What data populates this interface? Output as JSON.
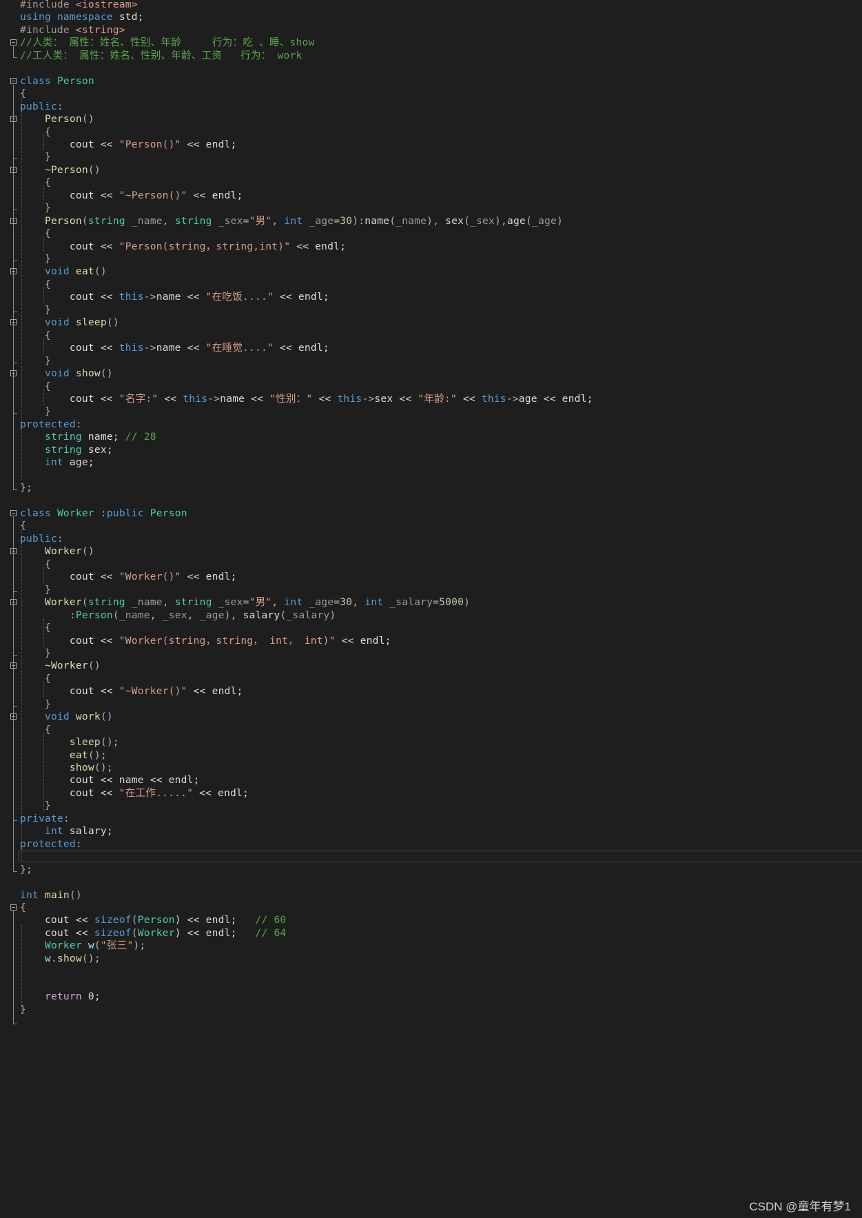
{
  "editor": {
    "lines": [
      [
        [
          "#include ",
          "pp"
        ],
        [
          "<iostream>",
          "str"
        ]
      ],
      [
        [
          "using",
          "kw"
        ],
        [
          " ",
          "tx"
        ],
        [
          "namespace",
          "kw"
        ],
        [
          " std;",
          "tx"
        ]
      ],
      [
        [
          "#include ",
          "pp"
        ],
        [
          "<string>",
          "str"
        ]
      ],
      [
        [
          "//人类： 属性：姓名、性别、年龄     行为：吃 、睡、show",
          "cm"
        ]
      ],
      [
        [
          "//工人类： 属性：姓名、性别、年龄、工资   行为： work",
          "cm"
        ]
      ],
      [],
      [
        [
          "class",
          "kw"
        ],
        [
          " ",
          "tx"
        ],
        [
          "Person",
          "cls"
        ]
      ],
      [
        [
          "{",
          "pn"
        ]
      ],
      [
        [
          "public",
          "kw"
        ],
        [
          ":",
          "pn"
        ]
      ],
      [
        [
          "    ",
          "tx"
        ],
        [
          "Person",
          "fn"
        ],
        [
          "()",
          "pn"
        ]
      ],
      [
        [
          "    {",
          "pn"
        ]
      ],
      [
        [
          "        cout << ",
          "tx"
        ],
        [
          "\"Person()\"",
          "str"
        ],
        [
          " << endl;",
          "tx"
        ]
      ],
      [
        [
          "    }",
          "pn"
        ]
      ],
      [
        [
          "    ~",
          "tx"
        ],
        [
          "Person",
          "fn"
        ],
        [
          "()",
          "pn"
        ]
      ],
      [
        [
          "    {",
          "pn"
        ]
      ],
      [
        [
          "        cout << ",
          "tx"
        ],
        [
          "\"~Person()\"",
          "str"
        ],
        [
          " << endl;",
          "tx"
        ]
      ],
      [
        [
          "    }",
          "pn"
        ]
      ],
      [
        [
          "    ",
          "tx"
        ],
        [
          "Person",
          "fn"
        ],
        [
          "(",
          "pn"
        ],
        [
          "string",
          "cls"
        ],
        [
          " ",
          "tx"
        ],
        [
          "_name",
          "prm"
        ],
        [
          ", ",
          "pn"
        ],
        [
          "string",
          "cls"
        ],
        [
          " ",
          "tx"
        ],
        [
          "_sex",
          "prm"
        ],
        [
          "=",
          "pn"
        ],
        [
          "\"男\"",
          "str"
        ],
        [
          ", ",
          "pn"
        ],
        [
          "int",
          "kw"
        ],
        [
          " ",
          "tx"
        ],
        [
          "_age",
          "prm"
        ],
        [
          "=",
          "pn"
        ],
        [
          "30",
          "num"
        ],
        [
          "):",
          "pn"
        ],
        [
          "name",
          "mem"
        ],
        [
          "(",
          "pn"
        ],
        [
          "_name",
          "prm"
        ],
        [
          "), ",
          "pn"
        ],
        [
          "sex",
          "mem"
        ],
        [
          "(",
          "pn"
        ],
        [
          "_sex",
          "prm"
        ],
        [
          "),",
          "pn"
        ],
        [
          "age",
          "mem"
        ],
        [
          "(",
          "pn"
        ],
        [
          "_age",
          "prm"
        ],
        [
          ")",
          "pn"
        ]
      ],
      [
        [
          "    {",
          "pn"
        ]
      ],
      [
        [
          "        cout << ",
          "tx"
        ],
        [
          "\"Person(string，string,int)\"",
          "str"
        ],
        [
          " << endl;",
          "tx"
        ]
      ],
      [
        [
          "    }",
          "pn"
        ]
      ],
      [
        [
          "    ",
          "tx"
        ],
        [
          "void",
          "kw"
        ],
        [
          " ",
          "tx"
        ],
        [
          "eat",
          "fn"
        ],
        [
          "()",
          "pn"
        ]
      ],
      [
        [
          "    {",
          "pn"
        ]
      ],
      [
        [
          "        cout << ",
          "tx"
        ],
        [
          "this",
          "kw"
        ],
        [
          "->",
          "pn"
        ],
        [
          "name",
          "mem"
        ],
        [
          " << ",
          "tx"
        ],
        [
          "\"在吃饭....\"",
          "str"
        ],
        [
          " << endl;",
          "tx"
        ]
      ],
      [
        [
          "    }",
          "pn"
        ]
      ],
      [
        [
          "    ",
          "tx"
        ],
        [
          "void",
          "kw"
        ],
        [
          " ",
          "tx"
        ],
        [
          "sleep",
          "fn"
        ],
        [
          "()",
          "pn"
        ]
      ],
      [
        [
          "    {",
          "pn"
        ]
      ],
      [
        [
          "        cout << ",
          "tx"
        ],
        [
          "this",
          "kw"
        ],
        [
          "->",
          "pn"
        ],
        [
          "name",
          "mem"
        ],
        [
          " << ",
          "tx"
        ],
        [
          "\"在睡觉....\"",
          "str"
        ],
        [
          " << endl;",
          "tx"
        ]
      ],
      [
        [
          "    }",
          "pn"
        ]
      ],
      [
        [
          "    ",
          "tx"
        ],
        [
          "void",
          "kw"
        ],
        [
          " ",
          "tx"
        ],
        [
          "show",
          "fn"
        ],
        [
          "()",
          "pn"
        ]
      ],
      [
        [
          "    {",
          "pn"
        ]
      ],
      [
        [
          "        cout << ",
          "tx"
        ],
        [
          "\"名字:\"",
          "str"
        ],
        [
          " << ",
          "tx"
        ],
        [
          "this",
          "kw"
        ],
        [
          "->",
          "pn"
        ],
        [
          "name",
          "mem"
        ],
        [
          " << ",
          "tx"
        ],
        [
          "\"性别：\"",
          "str"
        ],
        [
          " << ",
          "tx"
        ],
        [
          "this",
          "kw"
        ],
        [
          "->",
          "pn"
        ],
        [
          "sex",
          "mem"
        ],
        [
          " << ",
          "tx"
        ],
        [
          "\"年龄:\"",
          "str"
        ],
        [
          " << ",
          "tx"
        ],
        [
          "this",
          "kw"
        ],
        [
          "->",
          "pn"
        ],
        [
          "age",
          "mem"
        ],
        [
          " << endl;",
          "tx"
        ]
      ],
      [
        [
          "    }",
          "pn"
        ]
      ],
      [
        [
          "protected",
          "kw"
        ],
        [
          ":",
          "pn"
        ]
      ],
      [
        [
          "    ",
          "tx"
        ],
        [
          "string",
          "cls"
        ],
        [
          " name; ",
          "tx"
        ],
        [
          "// 28",
          "cm"
        ]
      ],
      [
        [
          "    ",
          "tx"
        ],
        [
          "string",
          "cls"
        ],
        [
          " sex;",
          "tx"
        ]
      ],
      [
        [
          "    ",
          "tx"
        ],
        [
          "int",
          "kw"
        ],
        [
          " age;",
          "tx"
        ]
      ],
      [],
      [
        [
          "};",
          "pn"
        ]
      ],
      [],
      [
        [
          "class",
          "kw"
        ],
        [
          " ",
          "tx"
        ],
        [
          "Worker",
          "cls"
        ],
        [
          " :",
          "pn"
        ],
        [
          "public",
          "kw"
        ],
        [
          " ",
          "tx"
        ],
        [
          "Person",
          "cls"
        ]
      ],
      [
        [
          "{",
          "pn"
        ]
      ],
      [
        [
          "public",
          "kw"
        ],
        [
          ":",
          "pn"
        ]
      ],
      [
        [
          "    ",
          "tx"
        ],
        [
          "Worker",
          "fn"
        ],
        [
          "()",
          "pn"
        ]
      ],
      [
        [
          "    {",
          "pn"
        ]
      ],
      [
        [
          "        cout << ",
          "tx"
        ],
        [
          "\"Worker()\"",
          "str"
        ],
        [
          " << endl;",
          "tx"
        ]
      ],
      [
        [
          "    }",
          "pn"
        ]
      ],
      [
        [
          "    ",
          "tx"
        ],
        [
          "Worker",
          "fn"
        ],
        [
          "(",
          "pn"
        ],
        [
          "string",
          "cls"
        ],
        [
          " ",
          "tx"
        ],
        [
          "_name",
          "prm"
        ],
        [
          ", ",
          "pn"
        ],
        [
          "string",
          "cls"
        ],
        [
          " ",
          "tx"
        ],
        [
          "_sex",
          "prm"
        ],
        [
          "=",
          "pn"
        ],
        [
          "\"男\"",
          "str"
        ],
        [
          ", ",
          "pn"
        ],
        [
          "int",
          "kw"
        ],
        [
          " ",
          "tx"
        ],
        [
          "_age",
          "prm"
        ],
        [
          "=",
          "pn"
        ],
        [
          "30",
          "num"
        ],
        [
          ", ",
          "pn"
        ],
        [
          "int",
          "kw"
        ],
        [
          " ",
          "tx"
        ],
        [
          "_salary",
          "prm"
        ],
        [
          "=",
          "pn"
        ],
        [
          "5000",
          "num"
        ],
        [
          ")",
          "pn"
        ]
      ],
      [
        [
          "        :",
          "pn"
        ],
        [
          "Person",
          "cls"
        ],
        [
          "(",
          "pn"
        ],
        [
          "_name",
          "prm"
        ],
        [
          ", ",
          "pn"
        ],
        [
          "_sex",
          "prm"
        ],
        [
          ", ",
          "pn"
        ],
        [
          "_age",
          "prm"
        ],
        [
          "), ",
          "pn"
        ],
        [
          "salary",
          "mem"
        ],
        [
          "(",
          "pn"
        ],
        [
          "_salary",
          "prm"
        ],
        [
          ")",
          "pn"
        ]
      ],
      [
        [
          "    {",
          "pn"
        ]
      ],
      [
        [
          "        cout << ",
          "tx"
        ],
        [
          "\"Worker(string，string， int， int)\"",
          "str"
        ],
        [
          " << endl;",
          "tx"
        ]
      ],
      [
        [
          "    }",
          "pn"
        ]
      ],
      [
        [
          "    ~",
          "tx"
        ],
        [
          "Worker",
          "fn"
        ],
        [
          "()",
          "pn"
        ]
      ],
      [
        [
          "    {",
          "pn"
        ]
      ],
      [
        [
          "        cout << ",
          "tx"
        ],
        [
          "\"~Worker()\"",
          "str"
        ],
        [
          " << endl;",
          "tx"
        ]
      ],
      [
        [
          "    }",
          "pn"
        ]
      ],
      [
        [
          "    ",
          "tx"
        ],
        [
          "void",
          "kw"
        ],
        [
          " ",
          "tx"
        ],
        [
          "work",
          "fn"
        ],
        [
          "()",
          "pn"
        ]
      ],
      [
        [
          "    {",
          "pn"
        ]
      ],
      [
        [
          "        ",
          "tx"
        ],
        [
          "sleep",
          "fn"
        ],
        [
          "();",
          "pn"
        ]
      ],
      [
        [
          "        ",
          "tx"
        ],
        [
          "eat",
          "fn"
        ],
        [
          "();",
          "pn"
        ]
      ],
      [
        [
          "        ",
          "tx"
        ],
        [
          "show",
          "fn"
        ],
        [
          "();",
          "pn"
        ]
      ],
      [
        [
          "        cout << ",
          "tx"
        ],
        [
          "name",
          "mem"
        ],
        [
          " << endl;",
          "tx"
        ]
      ],
      [
        [
          "        cout << ",
          "tx"
        ],
        [
          "\"在工作.....\"",
          "str"
        ],
        [
          " << endl;",
          "tx"
        ]
      ],
      [
        [
          "    }",
          "pn"
        ]
      ],
      [
        [
          "private",
          "kw"
        ],
        [
          ":",
          "pn"
        ]
      ],
      [
        [
          "    ",
          "tx"
        ],
        [
          "int",
          "kw"
        ],
        [
          " salary;",
          "tx"
        ]
      ],
      [
        [
          "protected",
          "kw"
        ],
        [
          ":",
          "pn"
        ]
      ],
      [],
      [
        [
          "};",
          "pn"
        ]
      ],
      [],
      [
        [
          "int",
          "kw"
        ],
        [
          " ",
          "tx"
        ],
        [
          "main",
          "fn"
        ],
        [
          "()",
          "pn"
        ]
      ],
      [
        [
          "{",
          "pn"
        ]
      ],
      [
        [
          "    cout << ",
          "tx"
        ],
        [
          "sizeof",
          "kw"
        ],
        [
          "(",
          "pn"
        ],
        [
          "Person",
          "cls"
        ],
        [
          ") << endl;   ",
          "tx"
        ],
        [
          "// 60",
          "cm"
        ]
      ],
      [
        [
          "    cout << ",
          "tx"
        ],
        [
          "sizeof",
          "kw"
        ],
        [
          "(",
          "pn"
        ],
        [
          "Worker",
          "cls"
        ],
        [
          ") << endl;   ",
          "tx"
        ],
        [
          "// 64",
          "cm"
        ]
      ],
      [
        [
          "    ",
          "tx"
        ],
        [
          "Worker",
          "cls"
        ],
        [
          " ",
          "tx"
        ],
        [
          "w",
          "var"
        ],
        [
          "(",
          "pn"
        ],
        [
          "\"张三\"",
          "str"
        ],
        [
          ");",
          "pn"
        ]
      ],
      [
        [
          "    ",
          "tx"
        ],
        [
          "w",
          "var"
        ],
        [
          ".",
          "pn"
        ],
        [
          "show",
          "fn"
        ],
        [
          "();",
          "pn"
        ]
      ],
      [],
      [],
      [
        [
          "    ",
          "tx"
        ],
        [
          "return",
          "ctl"
        ],
        [
          " 0;",
          "tx"
        ]
      ],
      [
        [
          "}",
          "pn"
        ]
      ]
    ]
  },
  "watermark": "CSDN @童年有梦1"
}
